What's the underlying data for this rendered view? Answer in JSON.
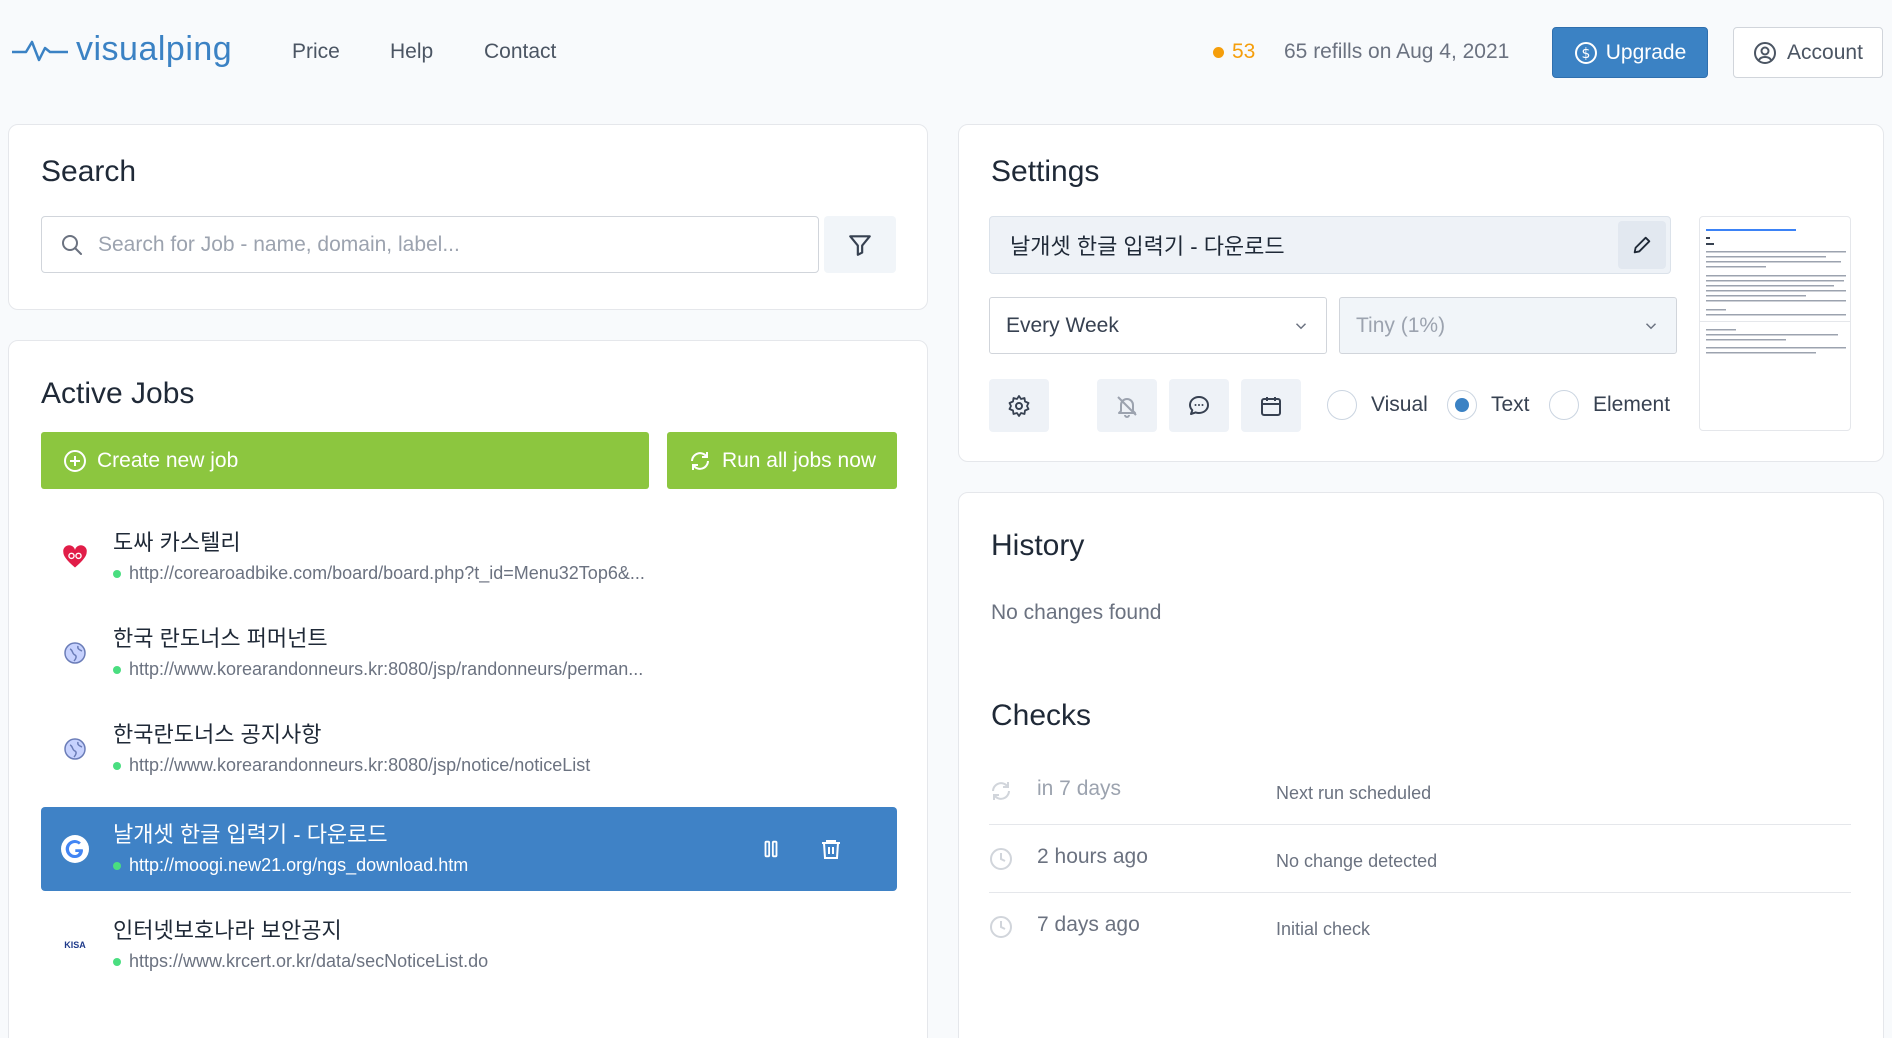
{
  "header": {
    "brand": "visualping",
    "nav": [
      "Price",
      "Help",
      "Contact"
    ],
    "credits_count": "53",
    "refills_text": "65 refills on Aug 4, 2021",
    "upgrade_label": "Upgrade",
    "account_label": "Account"
  },
  "search": {
    "title": "Search",
    "placeholder": "Search for Job - name, domain, label..."
  },
  "active_jobs": {
    "title": "Active Jobs",
    "create_label": "Create new job",
    "run_all_label": "Run all jobs now",
    "jobs": [
      {
        "name": "도싸 카스텔리",
        "url": "http://corearoadbike.com/board/board.php?t_id=Menu32Top6&...",
        "icon": "heart-bike-icon"
      },
      {
        "name": "한국 란도너스 퍼머넌트",
        "url": "http://www.korearandonneurs.kr:8080/jsp/randonneurs/perman...",
        "icon": "globe-icon"
      },
      {
        "name": "한국란도너스 공지사항",
        "url": "http://www.korearandonneurs.kr:8080/jsp/notice/noticeList",
        "icon": "globe-icon"
      },
      {
        "name": "날개셋 한글 입력기 - 다운로드",
        "url": "http://moogi.new21.org/ngs_download.htm",
        "icon": "google-icon",
        "active": true
      },
      {
        "name": "인터넷보호나라 보안공지",
        "url": "https://www.krcert.or.kr/data/secNoticeList.do",
        "icon": "kisa-logo"
      }
    ],
    "kisa_logo_text": "KISA"
  },
  "settings": {
    "title": "Settings",
    "job_name": "날개셋 한글 입력기 - 다운로드",
    "frequency": "Every Week",
    "sensitivity": "Tiny (1%)",
    "modes": [
      "Visual",
      "Text",
      "Element"
    ],
    "selected_mode": "Text"
  },
  "history": {
    "title": "History",
    "empty_text": "No changes found"
  },
  "checks": {
    "title": "Checks",
    "rows": [
      {
        "time": "in 7 days",
        "status": "Next run scheduled",
        "icon": "refresh-icon"
      },
      {
        "time": "2 hours ago",
        "status": "No change detected",
        "icon": "clock-icon"
      },
      {
        "time": "7 days ago",
        "status": "Initial check",
        "icon": "clock-icon"
      }
    ]
  },
  "colors": {
    "accent": "#3b82c4",
    "green": "#8cc63f",
    "credits": "#f59e0b",
    "active_job": "#3f82c6"
  }
}
